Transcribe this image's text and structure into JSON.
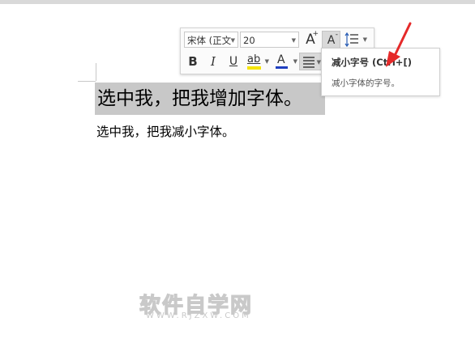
{
  "document": {
    "line1": "选中我，把我增加字体。",
    "line2": "选中我，把我减小字体。"
  },
  "mini_toolbar": {
    "font_name": "宋体 (正文",
    "font_size": "20",
    "grow_font_glyph": "A",
    "shrink_font_glyph": "A",
    "bold": "B",
    "italic": "I",
    "underline": "U",
    "highlight": "ab",
    "font_color_glyph": "A",
    "highlight_color": "#f5e400",
    "font_color": "#1f3fbf"
  },
  "tooltip": {
    "title": "减小字号 (Ctrl+[)",
    "description": "减小字体的字号。"
  },
  "annotation": {
    "arrow_color": "#e52a2a"
  },
  "watermark": {
    "cn": "软件自学网",
    "en": "WWW.RJZXW.COM"
  }
}
